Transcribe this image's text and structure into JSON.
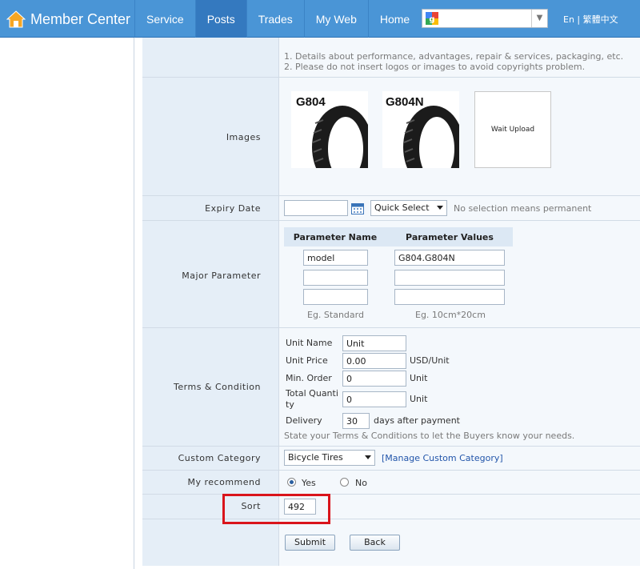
{
  "header": {
    "brand": "Member Center",
    "nav": [
      "Service",
      "Posts",
      "Trades",
      "My Web",
      "Home"
    ],
    "active_nav": "Posts",
    "language": "En | 繁體中文",
    "colors": {
      "topbar": "#4a95d6",
      "active": "#3479bf",
      "highlight": "#d9141b"
    }
  },
  "form": {
    "description_hints": [
      "1. Details about performance, advantages, repair & services, packaging, etc.",
      "2. Please do not insert logos or images to avoid copyrights problem."
    ],
    "images": {
      "label": "Images",
      "items": [
        {
          "caption": "G804",
          "kind": "bicycle tire image"
        },
        {
          "caption": "G804N",
          "kind": "bicycle tire image"
        },
        {
          "caption": "Wait Upload",
          "kind": "placeholder"
        }
      ]
    },
    "expiry": {
      "label": "Expiry Date",
      "value": "",
      "quick_select": "Quick Select",
      "hint": "No selection means permanent"
    },
    "major_parameter": {
      "label": "Major Parameter",
      "col_name": "Parameter Name",
      "col_values": "Parameter Values",
      "rows": [
        {
          "name": "model",
          "value": "G804.G804N"
        },
        {
          "name": "",
          "value": ""
        },
        {
          "name": "",
          "value": ""
        }
      ],
      "eg_name": "Eg. Standard",
      "eg_value": "Eg. 10cm*20cm"
    },
    "terms": {
      "label": "Terms & Condition",
      "unit_name_label": "Unit Name",
      "unit_name": "Unit",
      "unit_price_label": "Unit Price",
      "unit_price": "0.00",
      "currency": "USD/Unit",
      "min_order_label": "Min. Order",
      "min_order": "0",
      "min_order_unit": "Unit",
      "total_qty_label_1": "Total Quanti",
      "total_qty_label_2": "ty",
      "total_qty": "0",
      "total_qty_unit": "Unit",
      "delivery_label": "Delivery",
      "delivery": "30",
      "delivery_suffix": "days after payment",
      "hint": "State your Terms & Conditions to let the Buyers know your needs."
    },
    "custom_category": {
      "label": "Custom Category",
      "selected": "Bicycle Tires",
      "manage_link": "[Manage Custom Category]"
    },
    "recommend": {
      "label": "My recommend",
      "yes": "Yes",
      "no": "No",
      "selected": "Yes"
    },
    "sort": {
      "label": "Sort",
      "value": "492"
    },
    "buttons": {
      "submit": "Submit",
      "back": "Back"
    }
  }
}
